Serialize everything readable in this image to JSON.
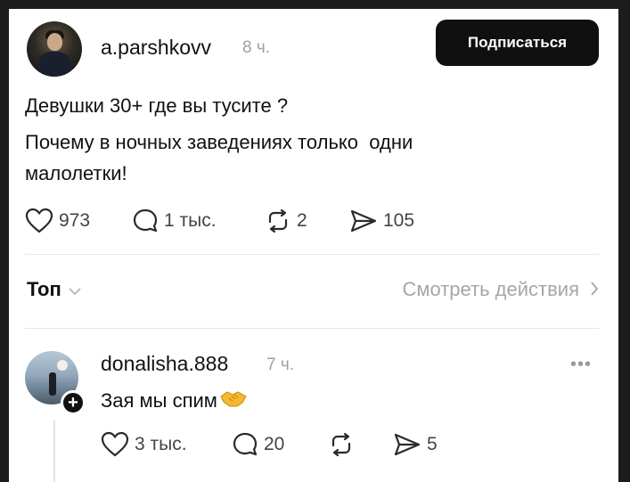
{
  "post": {
    "username": "a.parshkovv",
    "time": "8 ч.",
    "follow_label": "Подписаться",
    "text_lines": [
      "Девушки 30+ где вы тусите ?",
      "Почему в ночных заведениях только  одни",
      "малолетки!"
    ],
    "likes": "973",
    "comments": "1 тыс.",
    "reposts": "2",
    "shares": "105"
  },
  "replies_header": {
    "sort_label": "Топ",
    "activity_label": "Смотреть действия"
  },
  "reply": {
    "username": "donalisha.888",
    "time": "7 ч.",
    "text": "Зая мы спим",
    "emoji_icon": "handshake-icon",
    "likes": "3 тыс.",
    "comments": "20",
    "shares": "5"
  },
  "icons": {
    "like": "heart-icon",
    "comment": "comment-bubble-icon",
    "repost": "repost-arrows-icon",
    "share": "send-icon",
    "more": "more-dots-icon"
  },
  "colors": {
    "follow_button": "#101010",
    "muted_text": "#a0a0a0",
    "emoji": "#f5b82e"
  }
}
